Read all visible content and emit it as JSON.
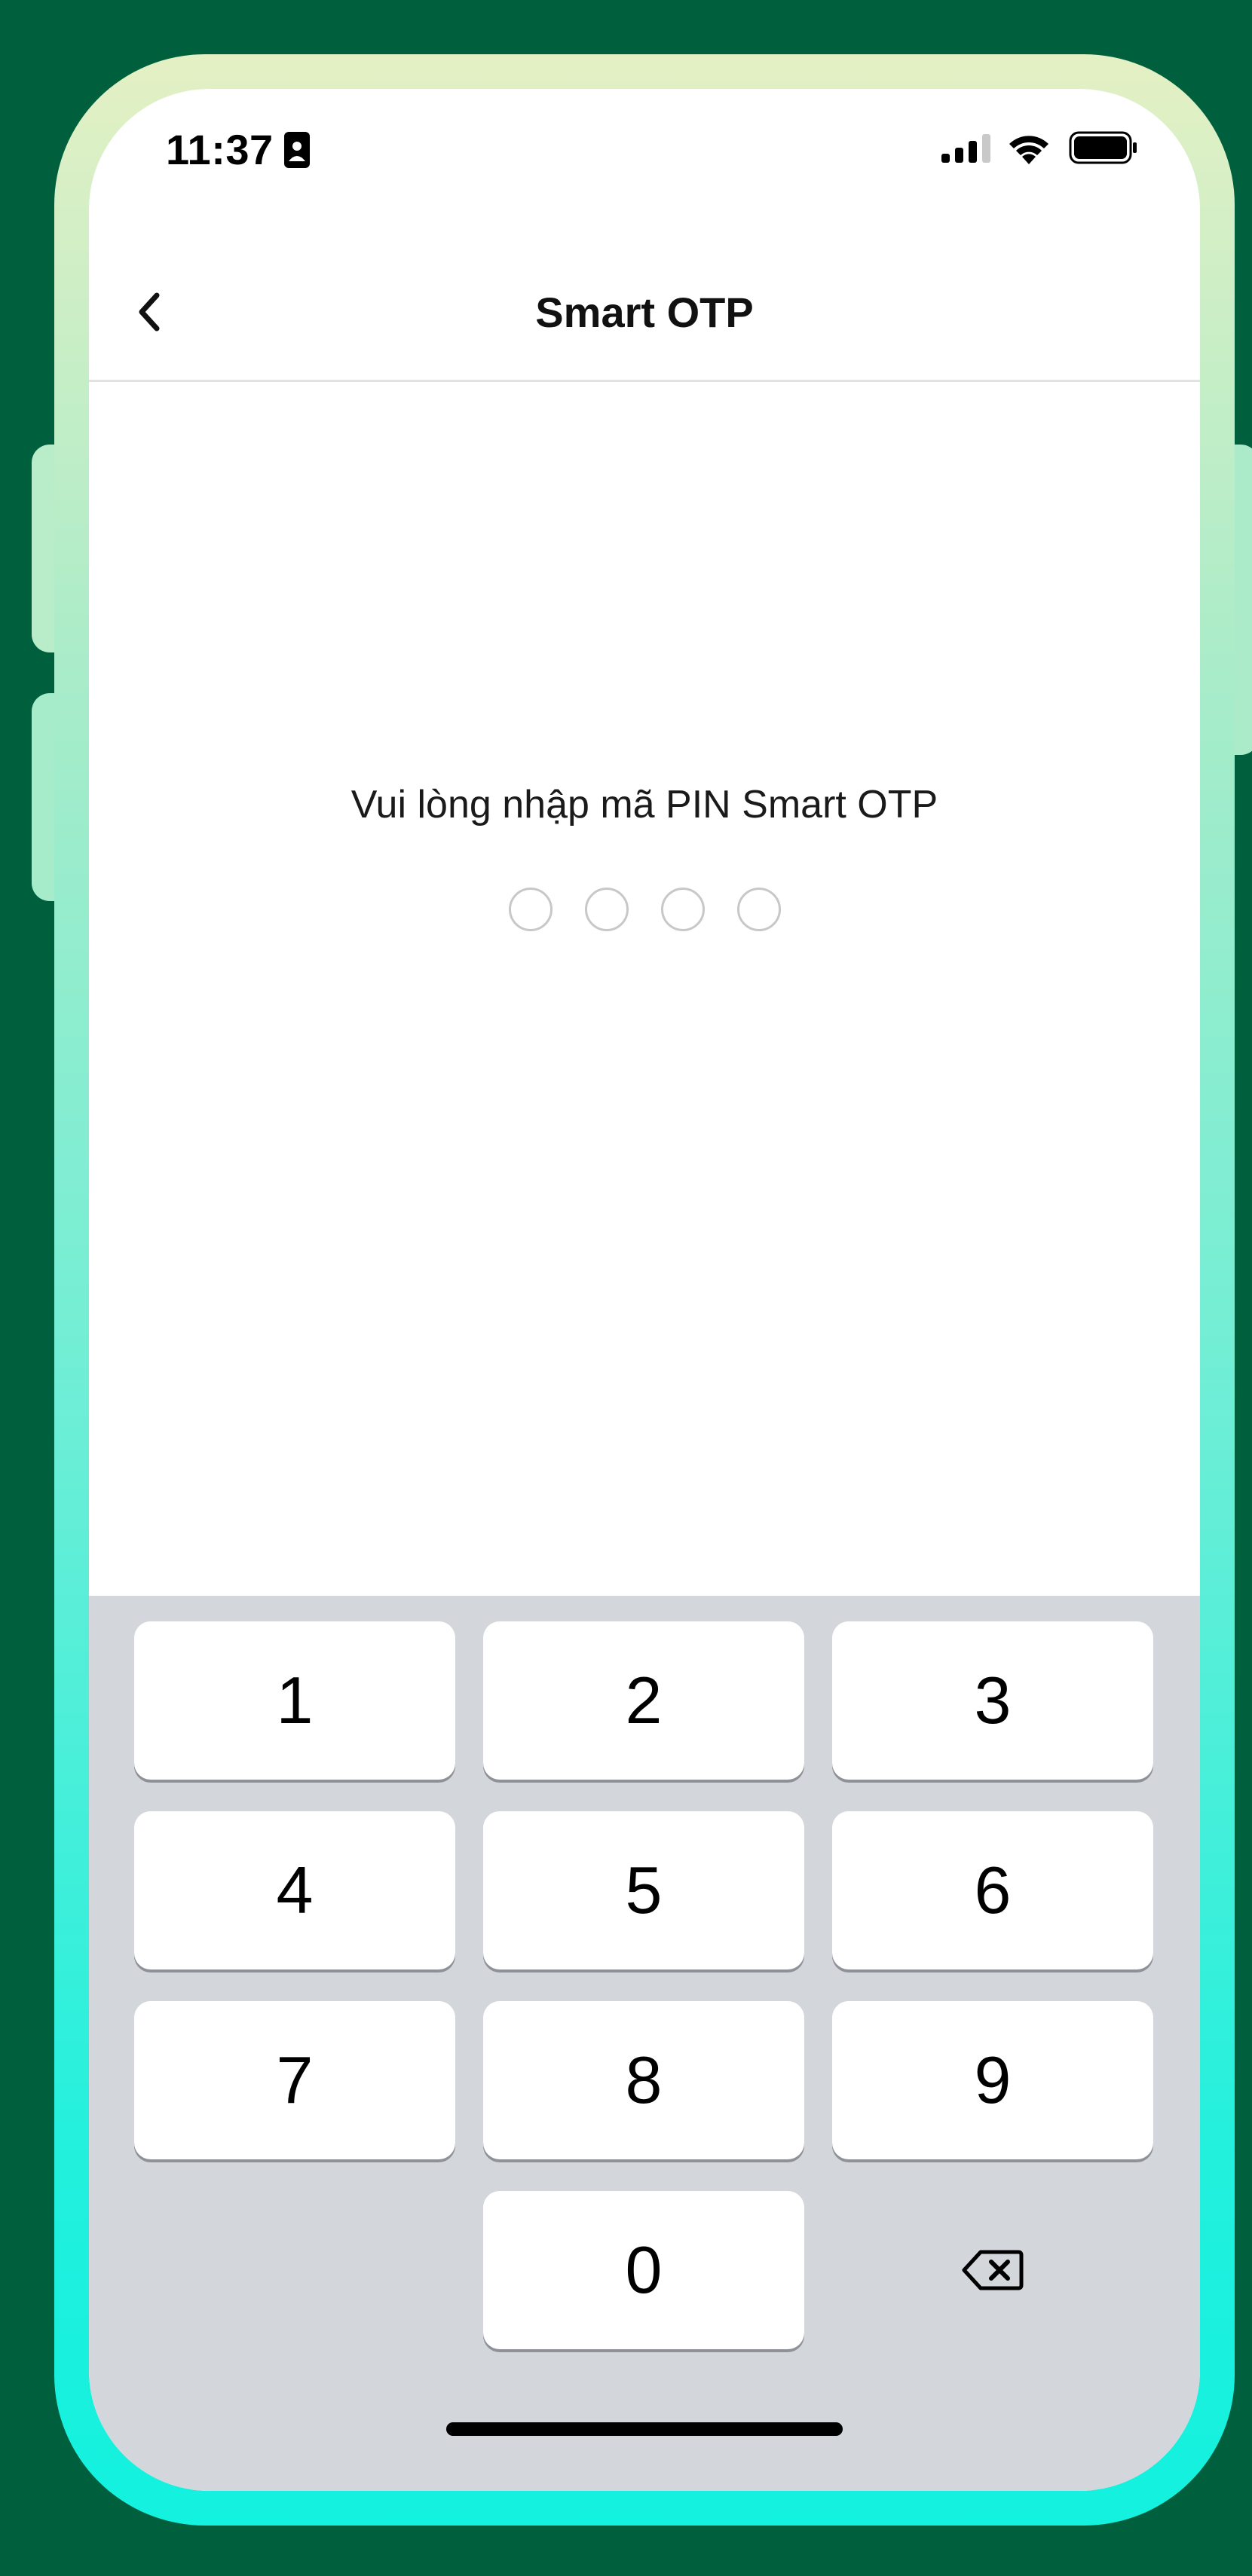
{
  "status_bar": {
    "time": "11:37",
    "icons": [
      "contact-card-icon",
      "cellular-signal-icon",
      "wifi-icon",
      "battery-icon"
    ]
  },
  "nav": {
    "title": "Smart OTP",
    "back_icon": "chevron-left-icon"
  },
  "pin": {
    "prompt": "Vui lòng nhập mã PIN Smart OTP",
    "length": 4,
    "filled": 0
  },
  "keypad": {
    "keys": [
      "1",
      "2",
      "3",
      "4",
      "5",
      "6",
      "7",
      "8",
      "9",
      "0"
    ],
    "backspace_icon": "backspace-icon"
  },
  "colors": {
    "background": "#005f3d",
    "keypad_background": "#d3d7dc",
    "key_background": "#ffffff",
    "frame_gradient_top": "#e4f0c4",
    "frame_gradient_bottom": "#13f1df"
  }
}
